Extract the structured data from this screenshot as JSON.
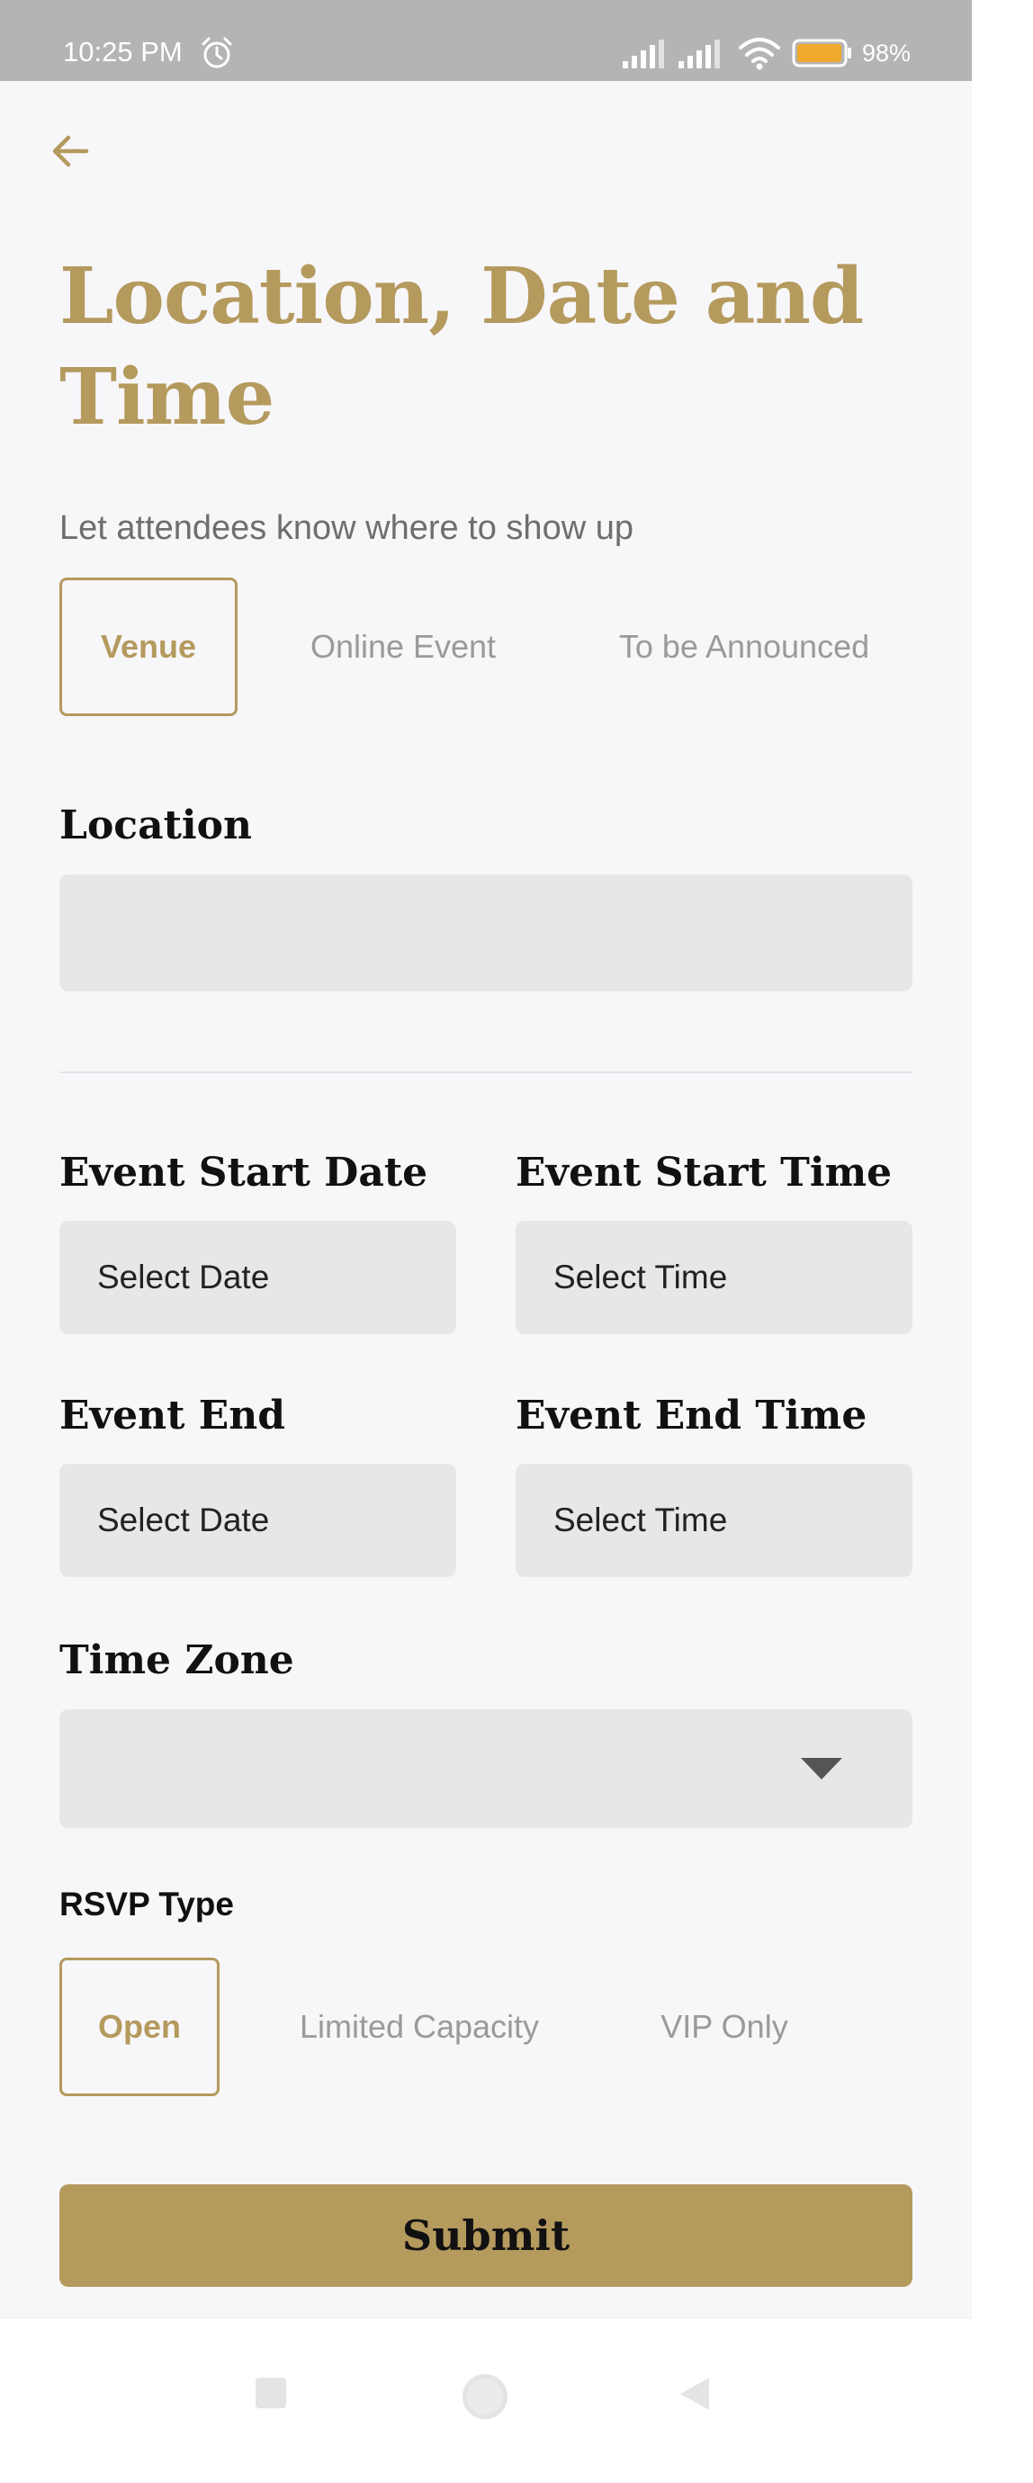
{
  "status_bar": {
    "time": "10:25 PM",
    "battery_percent": "98%",
    "battery_level": 0.98,
    "icons": [
      "alarm-icon",
      "signal-icon",
      "signal-icon",
      "wifi-icon",
      "battery-icon"
    ]
  },
  "header": {
    "back_icon": "arrow-left-icon",
    "title": "Location, Date and Time",
    "subtitle": "Let attendees know where to show up"
  },
  "location_type": {
    "options": [
      "Venue",
      "Online Event",
      "To be Announced"
    ],
    "selected": "Venue"
  },
  "location": {
    "label": "Location",
    "value": ""
  },
  "event_start_date": {
    "label": "Event Start Date",
    "placeholder": "Select Date"
  },
  "event_start_time": {
    "label": "Event Start Time",
    "placeholder": "Select Time"
  },
  "event_end_date": {
    "label": "Event End",
    "placeholder": "Select Date"
  },
  "event_end_time": {
    "label": "Event End Time",
    "placeholder": "Select Time"
  },
  "time_zone": {
    "label": "Time Zone",
    "value": "",
    "icon": "caret-down-icon"
  },
  "rsvp": {
    "label": "RSVP Type",
    "options": [
      "Open",
      "Limited Capacity",
      "VIP Only"
    ],
    "selected": "Open"
  },
  "submit": {
    "label": "Submit"
  },
  "colors": {
    "accent": "#b59a5e",
    "background": "#f7f7fa",
    "field_bg": "#e7e7e7",
    "muted_text": "#9a9a9a"
  },
  "nav_bar": {
    "icons": [
      "recents-square-icon",
      "home-circle-icon",
      "back-triangle-icon"
    ]
  }
}
